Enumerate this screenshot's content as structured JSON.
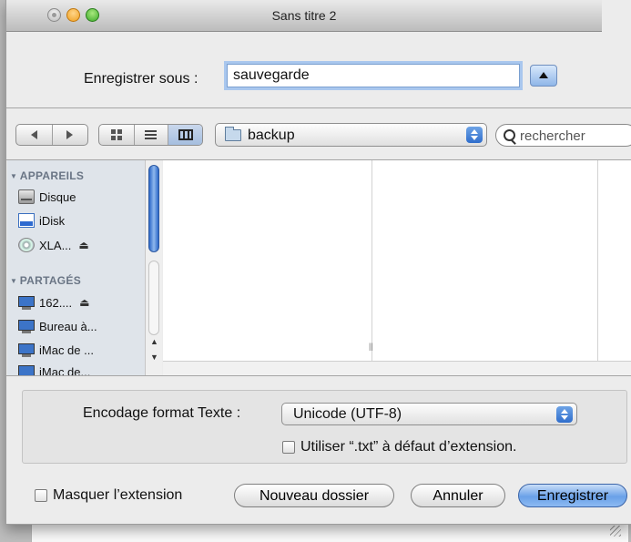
{
  "window": {
    "title": "Sans titre 2"
  },
  "save_as": {
    "label": "Enregistrer sous :",
    "value": "sauvegarde"
  },
  "toolbar": {
    "folder": "backup",
    "search_placeholder": "rechercher"
  },
  "sidebar": {
    "devices_title": "APPAREILS",
    "devices": [
      {
        "label": "Disque",
        "icon": "hard-disk-icon"
      },
      {
        "label": "iDisk",
        "icon": "idisk-icon"
      },
      {
        "label": "XLA...",
        "icon": "cd-icon",
        "eject": "⏏"
      }
    ],
    "shared_title": "PARTAGÉS",
    "shared": [
      {
        "label": "162....",
        "icon": "monitor-icon",
        "eject": "⏏"
      },
      {
        "label": "Bureau à...",
        "icon": "monitor-icon"
      },
      {
        "label": "iMac de ...",
        "icon": "monitor-icon"
      },
      {
        "label": "iMac de...",
        "icon": "monitor-icon"
      }
    ]
  },
  "encoding": {
    "label": "Encodage format Texte :",
    "value": "Unicode (UTF-8)",
    "txt_checkbox_label": "Utiliser “.txt” à défaut d’extension."
  },
  "footer": {
    "hide_extension_label": "Masquer l’extension",
    "new_folder": "Nouveau dossier",
    "cancel": "Annuler",
    "save": "Enregistrer"
  }
}
